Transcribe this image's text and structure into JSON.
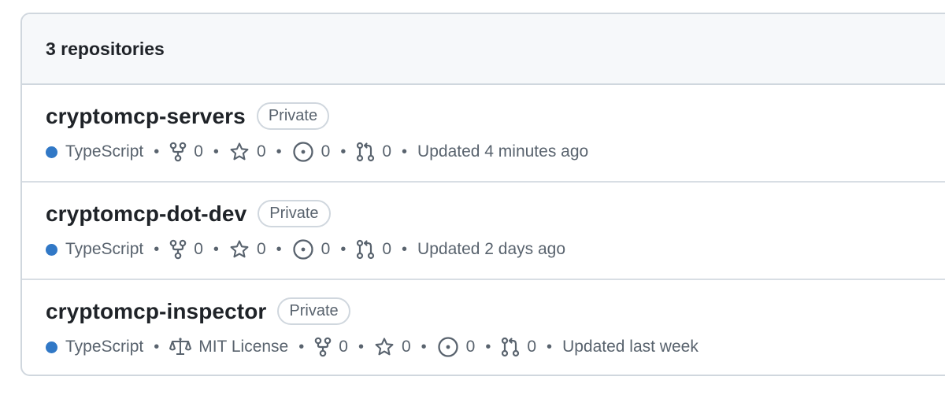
{
  "header": {
    "title": "3 repositories"
  },
  "colors": {
    "typescript": "#3178c6",
    "muted_text": "#59636e",
    "border": "#d0d7de"
  },
  "icons": {
    "fork": "fork-icon",
    "star": "star-icon",
    "issue": "issue-icon",
    "pull_request": "pull-request-icon",
    "license": "law-icon"
  },
  "repos": [
    {
      "name": "cryptomcp-servers",
      "visibility": "Private",
      "language": "TypeScript",
      "forks": "0",
      "stars": "0",
      "issues": "0",
      "pulls": "0",
      "updated": "Updated 4 minutes ago"
    },
    {
      "name": "cryptomcp-dot-dev",
      "visibility": "Private",
      "language": "TypeScript",
      "forks": "0",
      "stars": "0",
      "issues": "0",
      "pulls": "0",
      "updated": "Updated 2 days ago"
    },
    {
      "name": "cryptomcp-inspector",
      "visibility": "Private",
      "language": "TypeScript",
      "license": "MIT License",
      "forks": "0",
      "stars": "0",
      "issues": "0",
      "pulls": "0",
      "updated": "Updated last week"
    }
  ]
}
